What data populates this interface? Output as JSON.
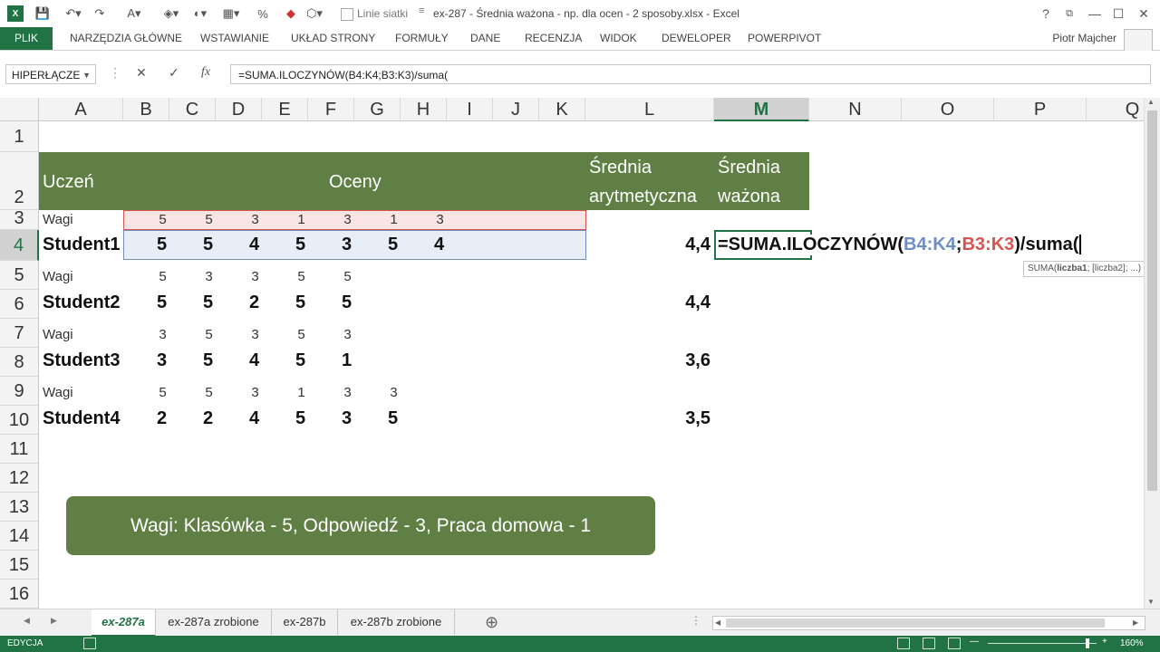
{
  "titlebar": {
    "title": "ex-287 - Średnia ważona - np. dla ocen - 2 sposoby.xlsx - Excel",
    "gridlines_label": "Linie siatki",
    "icons": [
      "excel-logo-icon",
      "save-icon",
      "undo-icon",
      "redo-icon",
      "font-size-icon",
      "text-color-icon",
      "fill-color-icon",
      "paint-icon",
      "border-icon",
      "percent-icon",
      "eraser-icon",
      "format-icon",
      "checkbox-icon"
    ]
  },
  "window": {
    "help": "?",
    "restore": "⧉",
    "minimize": "—",
    "maximize": "☐",
    "close": "✕"
  },
  "ribbon": {
    "tabs": [
      "PLIK",
      "NARZĘDZIA GŁÓWNE",
      "WSTAWIANIE",
      "UKŁAD STRONY",
      "FORMUŁY",
      "DANE",
      "RECENZJA",
      "WIDOK",
      "DEWELOPER",
      "POWERPIVOT"
    ],
    "user": "Piotr Majcher"
  },
  "formula_bar": {
    "name_box": "HIPERŁĄCZE",
    "cancel": "✕",
    "enter": "✓",
    "fx": "fx",
    "formula": "=SUMA.ILOCZYNÓW(B4:K4;B3:K3)/suma("
  },
  "columns": [
    "A",
    "B",
    "C",
    "D",
    "E",
    "F",
    "G",
    "H",
    "I",
    "J",
    "K",
    "L",
    "M",
    "N",
    "O",
    "P",
    "Q"
  ],
  "rows": [
    "1",
    "2",
    "3",
    "4",
    "5",
    "6",
    "7",
    "8",
    "9",
    "10",
    "11",
    "12",
    "13",
    "14",
    "15",
    "16"
  ],
  "sheet": {
    "header": {
      "uczen": "Uczeń",
      "oceny": "Oceny",
      "srednia_a1": "Średnia",
      "srednia_a2": "arytmetyczna",
      "srednia_w1": "Średnia",
      "srednia_w2": "ważona"
    },
    "r3": {
      "label": "Wagi",
      "vals": [
        "5",
        "5",
        "3",
        "1",
        "3",
        "1",
        "3"
      ]
    },
    "r4": {
      "label": "Student1",
      "vals": [
        "5",
        "5",
        "4",
        "5",
        "3",
        "5",
        "4"
      ],
      "avg": "4,4",
      "f1": "=SUMA.ILOCZYNÓW(",
      "f2": "B4:K4",
      "f3": ";",
      "f4": "B3:K3",
      "f5": ")/suma("
    },
    "r5": {
      "label": "Wagi",
      "vals": [
        "5",
        "3",
        "3",
        "5",
        "5"
      ]
    },
    "r6": {
      "label": "Student2",
      "vals": [
        "5",
        "5",
        "2",
        "5",
        "5"
      ],
      "avg": "4,4"
    },
    "r7": {
      "label": "Wagi",
      "vals": [
        "3",
        "5",
        "3",
        "5",
        "3"
      ]
    },
    "r8": {
      "label": "Student3",
      "vals": [
        "3",
        "5",
        "4",
        "5",
        "1"
      ],
      "avg": "3,6"
    },
    "r9": {
      "label": "Wagi",
      "vals": [
        "5",
        "5",
        "3",
        "1",
        "3",
        "3"
      ]
    },
    "r10": {
      "label": "Student4",
      "vals": [
        "2",
        "2",
        "4",
        "5",
        "3",
        "5"
      ],
      "avg": "3,5"
    },
    "tooltip_a": "SUMA(",
    "tooltip_b": "liczba1",
    "tooltip_c": "; [liczba2]; ...)",
    "banner": "Wagi: Klasówka - 5, Odpowiedź - 3, Praca domowa - 1"
  },
  "sheet_tabs": [
    "ex-287a",
    "ex-287a zrobione",
    "ex-287b",
    "ex-287b zrobione"
  ],
  "add_sheet": "⊕",
  "status": {
    "mode": "EDYCJA",
    "zoom": "160%"
  },
  "colors": {
    "accent": "#217346",
    "header_fill": "#5f7f45",
    "range1": "#6f8fc1",
    "range2": "#d9534f"
  }
}
